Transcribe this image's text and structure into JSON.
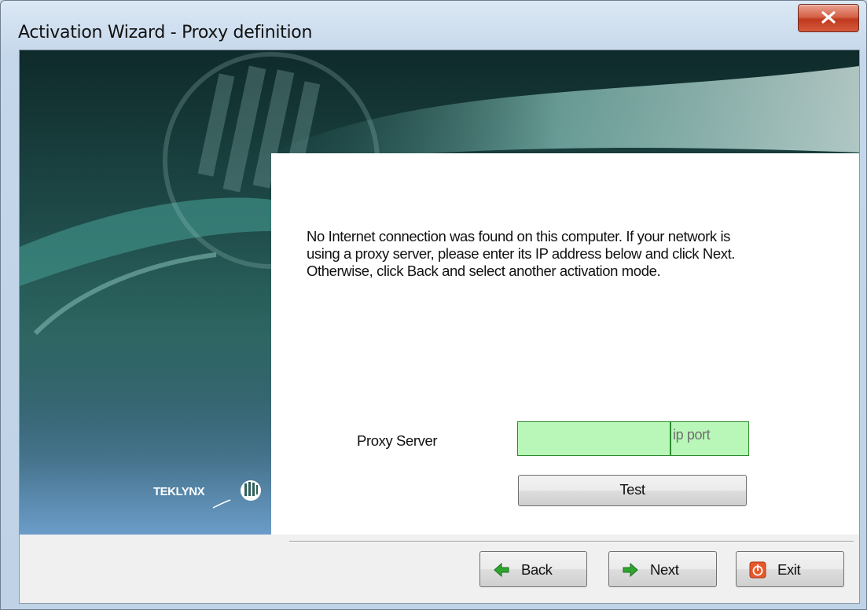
{
  "window": {
    "title": "Activation Wizard - Proxy definition"
  },
  "content": {
    "message_lines": [
      "No Internet connection was found on this computer. If your network is",
      "using a proxy server, please enter its IP address below and click Next.",
      "Otherwise, click Back and select another activation mode."
    ]
  },
  "proxy": {
    "label": "Proxy Server",
    "ip_value": "",
    "ip_placeholder": "ip",
    "port_value": "",
    "port_placeholder": "port",
    "test_label": "Test"
  },
  "brand": {
    "logo_text": "TEKLYNX"
  },
  "footer": {
    "back_label": "Back",
    "next_label": "Next",
    "exit_label": "Exit"
  },
  "colors": {
    "field_bg": "#b8f7b8",
    "field_border": "#2e8b2e",
    "close_red": "#c0391f",
    "arrow_green": "#2fa52f",
    "exit_orange": "#e8582a"
  },
  "icons": {
    "close": "close-x-icon",
    "back": "back-arrow-icon",
    "next": "next-arrow-icon",
    "exit": "power-icon"
  }
}
